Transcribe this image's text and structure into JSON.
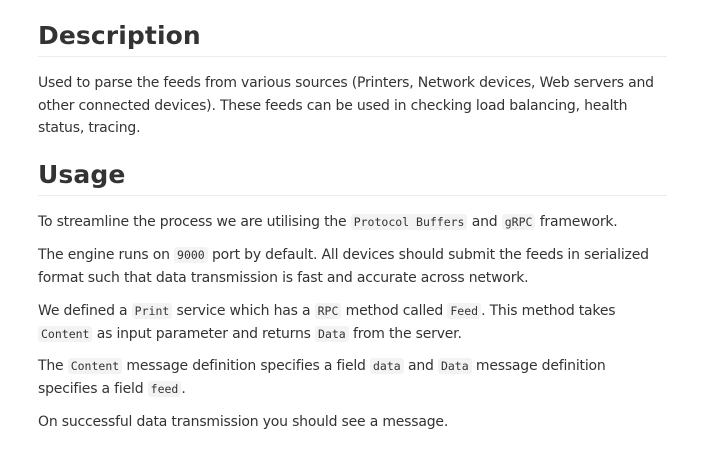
{
  "description": {
    "heading": "Description",
    "paragraph": "Used to parse the feeds from various sources (Printers, Network devices, Web servers and other connected devices). These feeds can be used in checking load balancing, health status, tracing."
  },
  "usage": {
    "heading": "Usage",
    "p1": {
      "t1": "To streamline the process we are utilising the ",
      "c1": "Protocol Buffers",
      "t2": " and ",
      "c2": "gRPC",
      "t3": " framework."
    },
    "p2": {
      "t1": "The engine runs on ",
      "c1": "9000",
      "t2": " port by default. All devices should submit the feeds in serialized format such that data transmission is fast and accurate across network."
    },
    "p3": {
      "t1": "We defined a ",
      "c1": "Print",
      "t2": " service which has a ",
      "c2": "RPC",
      "t3": " method called ",
      "c3": "Feed",
      "t4": ". This method takes ",
      "c4": "Content",
      "t5": " as input parameter and returns ",
      "c5": "Data",
      "t6": " from the server."
    },
    "p4": {
      "t1": "The ",
      "c1": "Content",
      "t2": " message definition specifies a field ",
      "c2": "data",
      "t3": " and ",
      "c3": "Data",
      "t4": " message definition specifies a field ",
      "c4": "feed",
      "t5": "."
    },
    "p5": "On successful data transmission you should see a message."
  }
}
